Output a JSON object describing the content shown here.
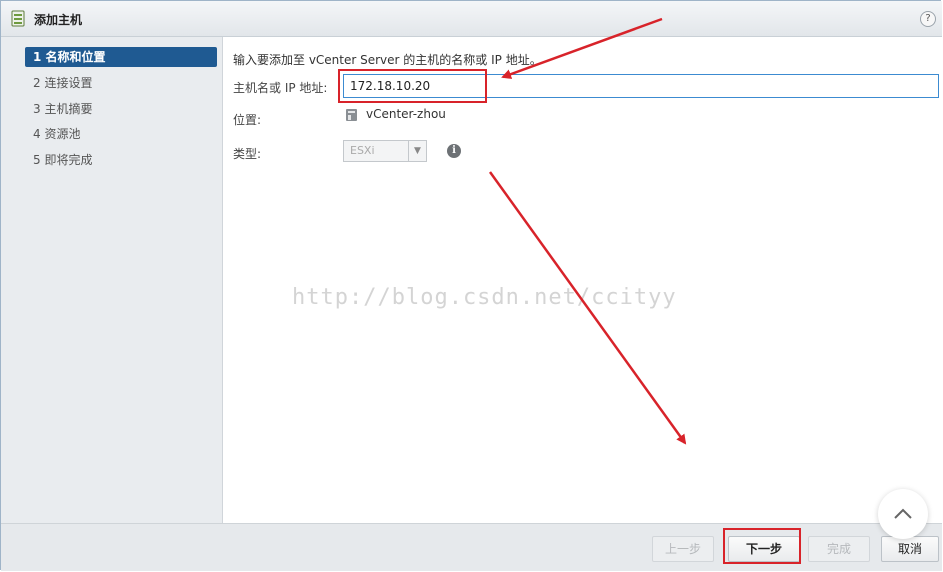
{
  "window": {
    "title": "添加主机",
    "help_label": "?"
  },
  "steps": [
    {
      "number": "1",
      "label": "名称和位置"
    },
    {
      "number": "2",
      "label": "连接设置"
    },
    {
      "number": "3",
      "label": "主机摘要"
    },
    {
      "number": "4",
      "label": "资源池"
    },
    {
      "number": "5",
      "label": "即将完成"
    }
  ],
  "form": {
    "instruction": "输入要添加至 vCenter Server 的主机的名称或 IP 地址。",
    "host_label": "主机名或 IP 地址:",
    "host_value": "172.18.10.20",
    "location_label": "位置:",
    "location_value": "vCenter-zhou",
    "type_label": "类型:",
    "type_value": "ESXi",
    "info_glyph": "i"
  },
  "watermark": "http://blog.csdn.net/ccityy",
  "footer": {
    "back_label": "上一步",
    "next_label": "下一步",
    "finish_label": "完成",
    "cancel_label": "取消"
  },
  "colors": {
    "accent": "#1f5a92",
    "annotation": "#d8232a",
    "input_focus": "#3c8bd1"
  },
  "icons": {
    "title": "host-add-icon",
    "location": "vcenter-icon",
    "info": "info-icon",
    "scroll_top": "chevron-up-icon"
  }
}
